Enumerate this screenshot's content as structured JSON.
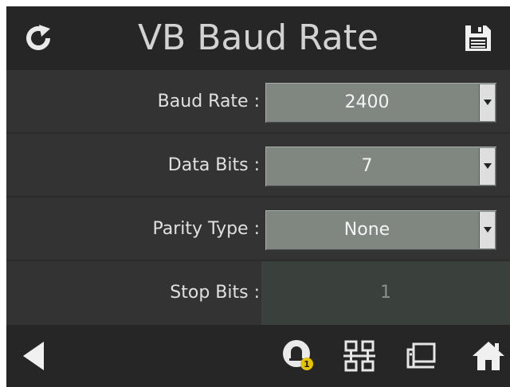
{
  "header": {
    "title": "VB Baud Rate",
    "refresh_icon": "refresh-icon",
    "save_icon": "save-icon"
  },
  "settings": [
    {
      "label": "Baud Rate :",
      "value": "2400",
      "type": "dropdown"
    },
    {
      "label": "Data Bits :",
      "value": "7",
      "type": "dropdown"
    },
    {
      "label": "Parity Type :",
      "value": "None",
      "type": "dropdown"
    },
    {
      "label": "Stop Bits :",
      "value": "1",
      "type": "readonly"
    }
  ],
  "footer": {
    "back_icon": "back-arrow-icon",
    "alarm_icon": "alarm-bell-icon",
    "alarm_count": "1",
    "network_icon": "network-icon",
    "terminal_icon": "terminal-icon",
    "home_icon": "home-icon"
  },
  "colors": {
    "background": "#333333",
    "header": "#262626",
    "dropdown": "#7f8780",
    "alarm_badge": "#e6c300"
  }
}
